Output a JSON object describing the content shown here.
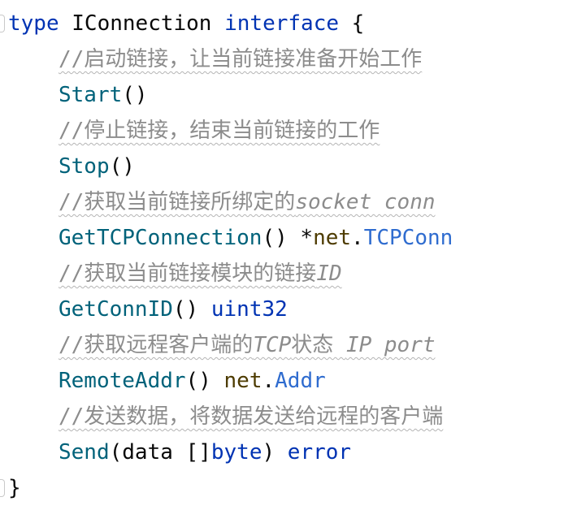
{
  "code": {
    "kw_type": "type",
    "iface_name": " IConnection ",
    "kw_interface": "interface",
    "open_brace": " {",
    "close_brace": "}",
    "indent": "    ",
    "comment_start_a": "//启动链接，让当前链接准备开始工作",
    "start_fn": "Start",
    "start_parens": "()",
    "comment_stop_a": "//停止链接，结束当前链接的工作",
    "stop_fn": "Stop",
    "stop_parens": "()",
    "comment_conn_a": "//获取当前链接所绑定的",
    "comment_conn_b": "socket conn",
    "getconn_fn": "GetTCPConnection",
    "getconn_parens": "() *",
    "pkg_net": "net",
    "dot": ".",
    "type_tcpconn": "TCPConn",
    "comment_id_a": "//获取当前链接模块的链接",
    "comment_id_b": "ID",
    "getid_fn": "GetConnID",
    "getid_parens": "() ",
    "type_uint32": "uint32",
    "comment_remote_a": "//获取远程客户端的",
    "comment_remote_b": "TCP",
    "comment_remote_c": "状态 ",
    "comment_remote_d": "IP port",
    "remote_fn": "RemoteAddr",
    "remote_parens": "() ",
    "type_addr": "Addr",
    "comment_send_a": "//发送数据，将数据发送给远程的客户端",
    "send_fn": "Send",
    "send_args_a": "(data []",
    "type_byte": "byte",
    "send_args_b": ") ",
    "type_error": "error"
  },
  "colors": {
    "keyword": "#0033b3",
    "function": "#00627a",
    "package": "#4d3b00",
    "type": "#2f6ccf",
    "comment": "#8c8c8c",
    "text": "#080808"
  }
}
